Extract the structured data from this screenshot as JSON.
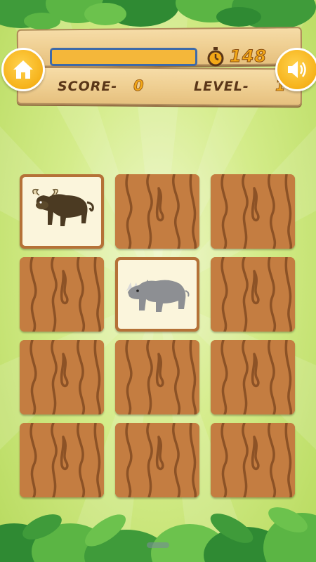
{
  "hud": {
    "timer_value": "148",
    "score_label": "SCORE-",
    "score_value": "0",
    "level_label": "LEVEL-",
    "level_value": "1",
    "progress_fraction": 1.0
  },
  "buttons": {
    "home_icon": "home-icon",
    "sound_icon": "speaker-icon"
  },
  "cards": [
    {
      "state": "face",
      "animal": "buffalo"
    },
    {
      "state": "back"
    },
    {
      "state": "back"
    },
    {
      "state": "back"
    },
    {
      "state": "face",
      "animal": "rhinoceros"
    },
    {
      "state": "back"
    },
    {
      "state": "back"
    },
    {
      "state": "back"
    },
    {
      "state": "back"
    },
    {
      "state": "back"
    },
    {
      "state": "back"
    },
    {
      "state": "back"
    }
  ],
  "colors": {
    "accent_orange": "#f3a818",
    "wood_brown": "#c17a3f",
    "progress_border": "#3e6aa8",
    "text_brown": "#5a3618"
  }
}
